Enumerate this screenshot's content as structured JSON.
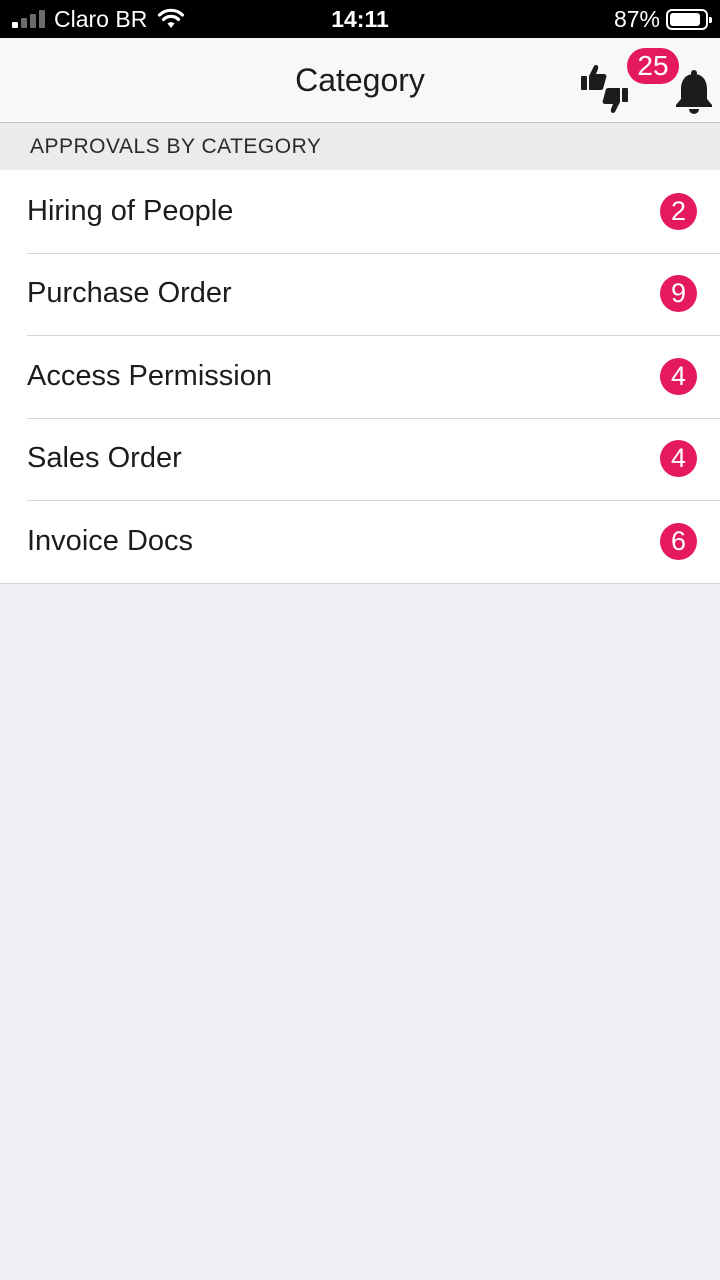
{
  "status_bar": {
    "carrier": "Claro BR",
    "time": "14:11",
    "battery_percent_text": "87%",
    "battery_level": 0.87,
    "signal_bars_active": 1,
    "signal_bars_total": 4,
    "wifi": true
  },
  "nav": {
    "title": "Category",
    "notification_count": "25",
    "icons": [
      "thumbs-up-down-icon",
      "bell-icon"
    ]
  },
  "section": {
    "header": "APPROVALS BY CATEGORY"
  },
  "categories": [
    {
      "label": "Hiring of People",
      "count": "2"
    },
    {
      "label": "Purchase Order",
      "count": "9"
    },
    {
      "label": "Access Permission",
      "count": "4"
    },
    {
      "label": "Sales Order",
      "count": "4"
    },
    {
      "label": "Invoice Docs",
      "count": "6"
    }
  ],
  "colors": {
    "badge": "#e5195f",
    "status_bar_bg": "#000000",
    "nav_bg": "#f8f8f8",
    "page_bg": "#efeff4"
  }
}
